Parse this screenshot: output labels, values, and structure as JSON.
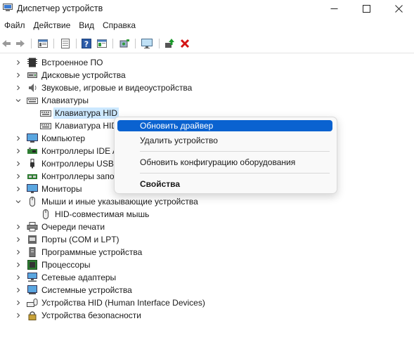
{
  "window": {
    "title": "Диспетчер устройств",
    "controls": {
      "minimize": "—",
      "maximize": "☐",
      "close": "✕"
    }
  },
  "menu": [
    "Файл",
    "Действие",
    "Вид",
    "Справка"
  ],
  "toolbar": {
    "icons": [
      "back-icon",
      "forward-icon",
      "properties-icon",
      "show-hide-icon",
      "help-icon",
      "view-icon",
      "scan-hardware-icon",
      "monitor-icon",
      "update-driver-icon",
      "uninstall-icon"
    ]
  },
  "tree": {
    "items": [
      {
        "label": "Встроенное ПО",
        "expanded": false,
        "icon": "firmware-icon"
      },
      {
        "label": "Дисковые устройства",
        "expanded": false,
        "icon": "disk-icon"
      },
      {
        "label": "Звуковые, игровые и видеоустройства",
        "expanded": false,
        "icon": "speaker-icon"
      },
      {
        "label": "Клавиатуры",
        "expanded": true,
        "icon": "keyboard-icon"
      },
      {
        "label": "Клавиатура HID",
        "child": true,
        "selected": true,
        "icon": "keyboard-icon"
      },
      {
        "label": "Клавиатура HID",
        "child": true,
        "icon": "keyboard-icon"
      },
      {
        "label": "Компьютер",
        "expanded": false,
        "icon": "computer-icon"
      },
      {
        "label": "Контроллеры IDE A",
        "expanded": false,
        "icon": "ide-controller-icon"
      },
      {
        "label": "Контроллеры USB",
        "expanded": false,
        "icon": "usb-icon"
      },
      {
        "label": "Контроллеры запо",
        "expanded": false,
        "icon": "storage-controller-icon"
      },
      {
        "label": "Мониторы",
        "expanded": false,
        "icon": "monitor-icon"
      },
      {
        "label": "Мыши и иные указывающие устройства",
        "expanded": true,
        "icon": "mouse-icon"
      },
      {
        "label": "HID-совместимая мышь",
        "child": true,
        "icon": "mouse-icon"
      },
      {
        "label": "Очереди печати",
        "expanded": false,
        "icon": "printer-icon"
      },
      {
        "label": "Порты (COM и LPT)",
        "expanded": false,
        "icon": "port-icon"
      },
      {
        "label": "Программные устройства",
        "expanded": false,
        "icon": "software-device-icon"
      },
      {
        "label": "Процессоры",
        "expanded": false,
        "icon": "processor-icon"
      },
      {
        "label": "Сетевые адаптеры",
        "expanded": false,
        "icon": "network-adapter-icon"
      },
      {
        "label": "Системные устройства",
        "expanded": false,
        "icon": "system-device-icon"
      },
      {
        "label": "Устройства HID (Human Interface Devices)",
        "expanded": false,
        "icon": "hid-icon"
      },
      {
        "label": "Устройства безопасности",
        "expanded": false,
        "icon": "security-device-icon"
      }
    ]
  },
  "context_menu": {
    "items": [
      {
        "label": "Обновить драйвер",
        "highlighted": true
      },
      {
        "label": "Удалить устройство"
      },
      {
        "label": "Обновить конфигурацию оборудования"
      },
      {
        "label": "Свойства",
        "bold": true
      }
    ]
  },
  "colors": {
    "accent": "#0a62d0",
    "selection": "#cce8ff",
    "uninstall_red": "#d41414",
    "update_green": "#1a9a2a"
  }
}
